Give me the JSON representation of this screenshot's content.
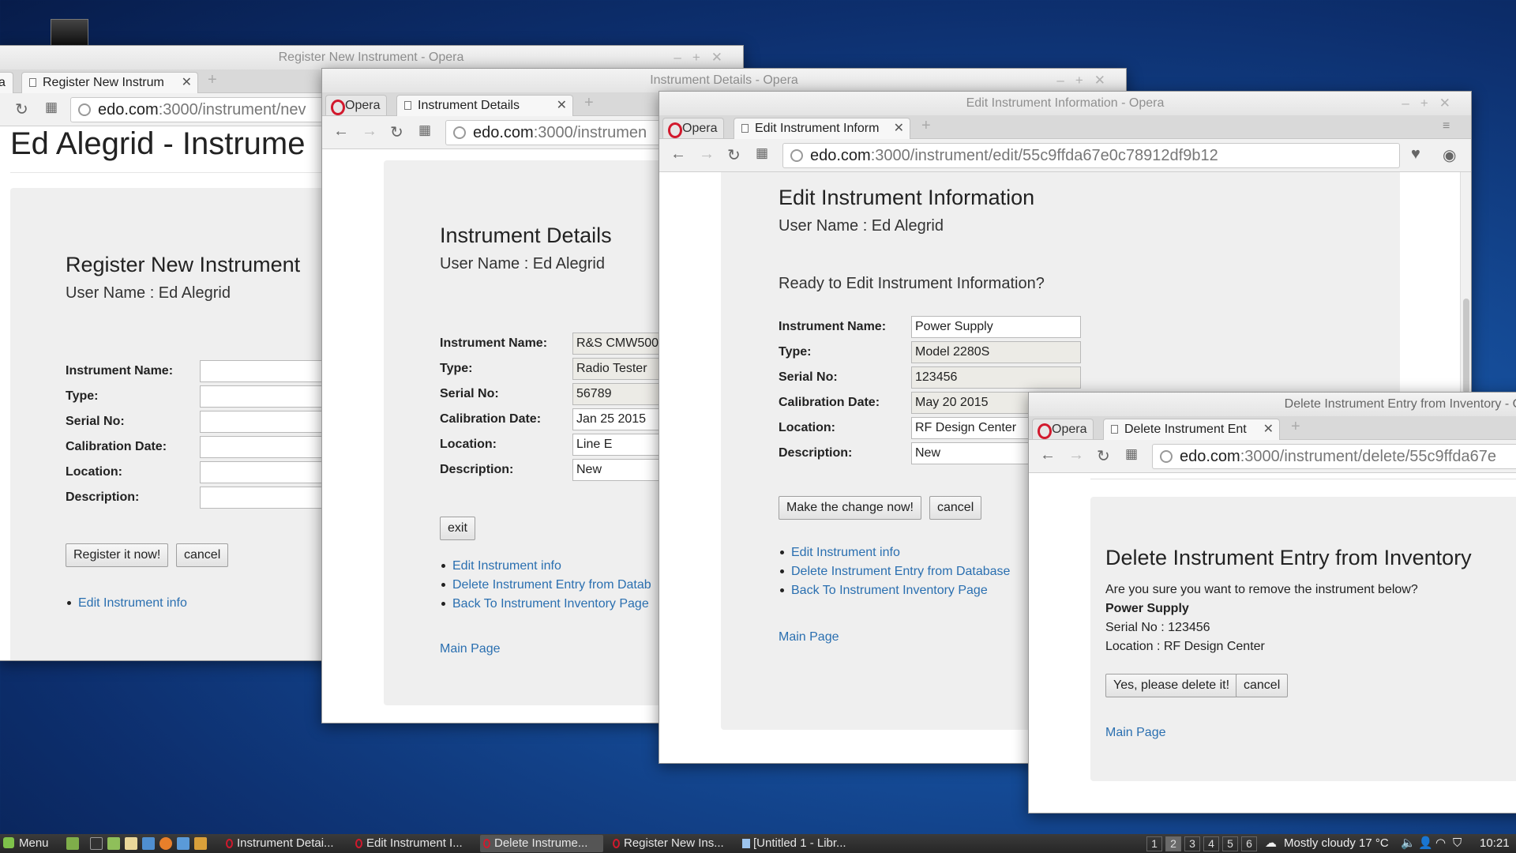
{
  "taskbar": {
    "menu_label": "Menu",
    "items": [
      "Instrument Detai...",
      "Edit Instrument I...",
      "Delete Instrume...",
      "Register New Ins...",
      "[Untitled 1 - Libr..."
    ],
    "workspaces": [
      "1",
      "2",
      "3",
      "4",
      "5",
      "6"
    ],
    "weather": "Mostly cloudy 17 °C",
    "clock": "10:21"
  },
  "win_register": {
    "title": "Register New Instrument - Opera",
    "tab_prev": "a",
    "tab": "Register New Instrum",
    "url_host": "edo.com",
    "url_path": ":3000/instrument/nev",
    "page_header": "Ed Alegrid - Instrume",
    "heading": "Register New Instrument",
    "username": "User Name : Ed Alegrid",
    "labels": [
      "Instrument Name:",
      "Type:",
      "Serial No:",
      "Calibration Date:",
      "Location:",
      "Description:"
    ],
    "submit": "Register it now!",
    "cancel": "cancel",
    "link_edit": "Edit Instrument info"
  },
  "win_details": {
    "title": "Instrument Details - Opera",
    "opera": "Opera",
    "tab": "Instrument Details",
    "url_host": "edo.com",
    "url_path": ":3000/instrumen",
    "heading": "Instrument Details",
    "username": "User Name : Ed Alegrid",
    "fields": [
      {
        "label": "Instrument Name:",
        "value": "R&S CMW500"
      },
      {
        "label": "Type:",
        "value": "Radio Tester"
      },
      {
        "label": "Serial No:",
        "value": "56789"
      },
      {
        "label": "Calibration Date:",
        "value": "Jan 25 2015"
      },
      {
        "label": "Location:",
        "value": "Line E"
      },
      {
        "label": "Description:",
        "value": "New"
      }
    ],
    "exit": "exit",
    "links": [
      "Edit Instrument info",
      "Delete Instrument Entry from Datab",
      "Back To Instrument Inventory Page"
    ],
    "main_page": "Main Page"
  },
  "win_edit": {
    "title": "Edit Instrument Information - Opera",
    "opera": "Opera",
    "tab": "Edit Instrument Inform",
    "url_host": "edo.com",
    "url_path": ":3000/instrument/edit/55c9ffda67e0c78912df9b12",
    "heading": "Edit Instrument Information",
    "username": "User Name : Ed Alegrid",
    "prompt": "Ready to Edit Instrument Information?",
    "fields": [
      {
        "label": "Instrument Name:",
        "value": "Power Supply"
      },
      {
        "label": "Type:",
        "value": "Model 2280S"
      },
      {
        "label": "Serial No:",
        "value": "123456"
      },
      {
        "label": "Calibration Date:",
        "value": "May 20 2015"
      },
      {
        "label": "Location:",
        "value": "RF Design Center"
      },
      {
        "label": "Description:",
        "value": "New"
      }
    ],
    "submit": "Make the change now!",
    "cancel": "cancel",
    "links": [
      "Edit Instrument info",
      "Delete Instrument Entry from Database",
      "Back To Instrument Inventory Page"
    ],
    "main_page": "Main Page"
  },
  "win_delete": {
    "title": "Delete Instrument Entry from Inventory - Op",
    "opera": "Opera",
    "tab": "Delete Instrument Ent",
    "url_host": "edo.com",
    "url_path": ":3000/instrument/delete/55c9ffda67e",
    "heading": "Delete Instrument Entry from Inventory",
    "question": "Are you sure you want to remove the instrument below?",
    "name": "Power Supply",
    "serial": "Serial No : 123456",
    "location": "Location : RF Design Center",
    "confirm": "Yes, please delete it!",
    "cancel": "cancel",
    "main_page": "Main Page"
  }
}
